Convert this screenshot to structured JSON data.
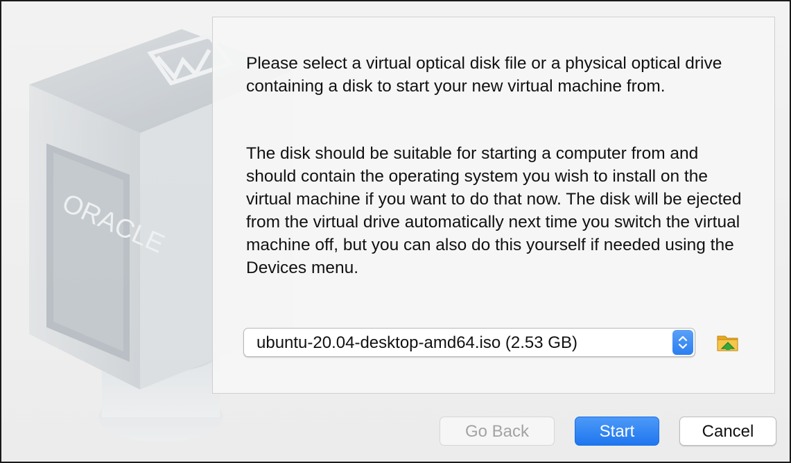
{
  "watermark": {
    "brand_text": "ORACLE",
    "icon": "virtualbox-cube-icon"
  },
  "content": {
    "paragraph_1": "Please select a virtual optical disk file or a physical optical drive containing a disk to start your new virtual machine from.",
    "paragraph_2": "The disk should be suitable for starting a computer from and should contain the operating system you wish to install on the virtual machine if you want to do that now. The disk will be ejected from the virtual drive automatically next time you switch the virtual machine off, but you can also do this yourself if needed using the Devices menu."
  },
  "disk_select": {
    "value": "ubuntu-20.04-desktop-amd64.iso (2.53 GB)",
    "stepper_icon": "up-down-chevron-icon",
    "browse_icon": "folder-icon"
  },
  "buttons": {
    "back": "Go Back",
    "start": "Start",
    "cancel": "Cancel"
  },
  "colors": {
    "accent": "#2c7ff0",
    "disabled_text": "#a3a3a3"
  }
}
